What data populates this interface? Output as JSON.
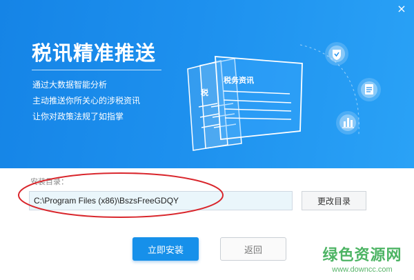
{
  "window": {
    "close_glyph": "×"
  },
  "banner": {
    "title": "税讯精准推送",
    "features": [
      "通过大数据智能分析",
      "主动推送你所关心的涉税资讯",
      "让你对政策法规了如指掌"
    ],
    "illustration": {
      "card_title": "税务资讯",
      "back_card_label": "税"
    },
    "icons": [
      "shield-icon",
      "document-icon",
      "bar-chart-icon"
    ]
  },
  "install": {
    "dir_label": "安装目录：",
    "path_value": "C:\\Program Files (x86)\\BszsFreeGDQY",
    "change_dir_label": "更改目录",
    "install_label": "立即安装",
    "back_label": "返回"
  },
  "watermark": {
    "title": "绿色资源网",
    "url": "www.downcc.com"
  },
  "colors": {
    "banner_blue": "#1d90ee",
    "install_button": "#1690ea",
    "highlight_ellipse": "#d9262c",
    "watermark_green": "#2fa84a"
  }
}
